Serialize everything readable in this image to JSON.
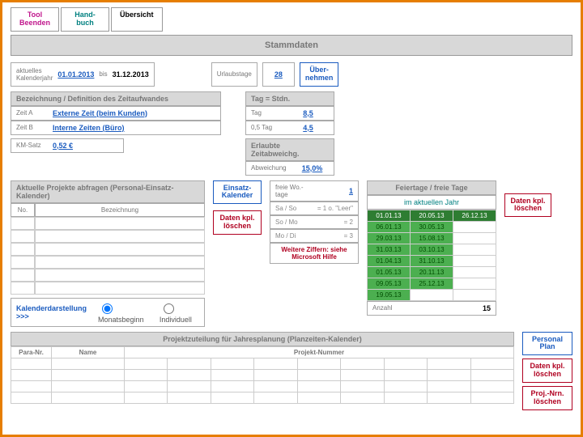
{
  "tabs": {
    "tool": "Tool\nBeenden",
    "hand": "Hand-\nbuch",
    "ubersicht": "Übersicht"
  },
  "title": "Stammdaten",
  "year": {
    "label": "aktuelles\nKalenderjahr",
    "from": "01.01.2013",
    "bis": "bis",
    "to": "31.12.2013"
  },
  "urlaub": {
    "label": "Urlaubstage",
    "value": "28",
    "btn": "Über-\nnehmen"
  },
  "zeit_header": "Bezeichnung / Definition des Zeitaufwandes",
  "zeit_a": {
    "k": "Zeit A",
    "v": "Externe Zeit (beim Kunden)"
  },
  "zeit_b": {
    "k": "Zeit B",
    "v": "Interne Zeiten (Büro)"
  },
  "km": {
    "k": "KM-Satz",
    "v": "0,52 €"
  },
  "tag_header": "Tag = Stdn.",
  "tag_full": {
    "k": "Tag",
    "v": "8,5"
  },
  "tag_half": {
    "k": "0,5 Tag",
    "v": "4,5"
  },
  "abw": {
    "header": "Erlaubte Zeitabweichg.",
    "k": "Abweichung",
    "v": "15,0%"
  },
  "proj_header": "Aktuelle Projekte abfragen (Personal-Einsatz-Kalender)",
  "proj_cols": {
    "no": "No.",
    "bez": "Bezeichnung"
  },
  "einsatz_btn": "Einsatz-\nKalender",
  "loeschen_btn": "Daten kpl.\nlöschen",
  "kalender_label": "Kalenderdarstellung >>>",
  "radio_monat": "Monatsbeginn",
  "radio_indiv": "Individuell",
  "wotage": {
    "label": "freie Wo.-\ntage",
    "value": "1",
    "rows": [
      [
        "Sa / So",
        "= 1 o. \"Leer\""
      ],
      [
        "So / Mo",
        "= 2"
      ],
      [
        "Mo / Di",
        "= 3"
      ]
    ],
    "hint": "Weitere Ziffern: siehe\nMicrosoft Hilfe"
  },
  "feier": {
    "header": "Feiertage / freie Tage",
    "sub": "im aktuellen Jahr",
    "dates": [
      [
        "01.01.13",
        "20.05.13",
        "26.12.13"
      ],
      [
        "06.01.13",
        "30.05.13",
        ""
      ],
      [
        "29.03.13",
        "15.08.13",
        ""
      ],
      [
        "31.03.13",
        "03.10.13",
        ""
      ],
      [
        "01.04.13",
        "31.10.13",
        ""
      ],
      [
        "01.05.13",
        "20.11.13",
        ""
      ],
      [
        "09.05.13",
        "25.12.13",
        ""
      ],
      [
        "19.05.13",
        "",
        ""
      ]
    ],
    "anzahl_label": "Anzahl",
    "anzahl": "15"
  },
  "alloc": {
    "header": "Projektzuteilung für Jahresplanung (Planzeiten-Kalender)",
    "para": "Para-Nr.",
    "name": "Name",
    "pnum": "Projekt-Nummer"
  },
  "side": {
    "plan": "Personal\nPlan",
    "loeschen": "Daten kpl.\nlöschen",
    "projnrn": "Proj.-Nrn.\nlöschen"
  }
}
